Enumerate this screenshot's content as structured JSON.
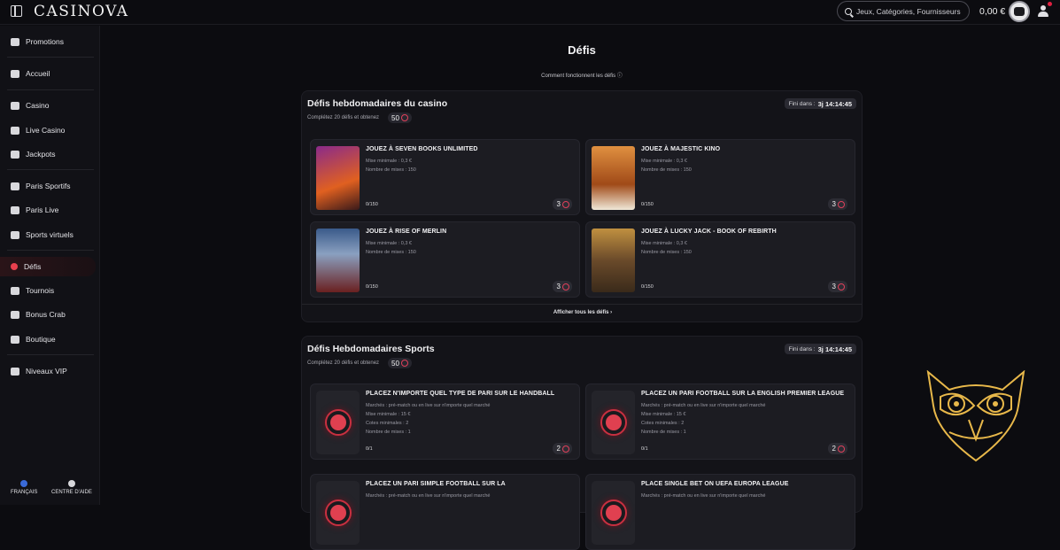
{
  "header": {
    "logo": "CASINOVA",
    "search_placeholder": "Jeux, Catégories, Fournisseurs",
    "balance": "0,00 €"
  },
  "sidebar": {
    "items": [
      {
        "label": "Promotions",
        "icon": "gift-icon"
      },
      {
        "label": "Accueil",
        "icon": "home-icon"
      },
      {
        "label": "Casino",
        "icon": "cards-icon"
      },
      {
        "label": "Live Casino",
        "icon": "live-dealer-icon"
      },
      {
        "label": "Jackpots",
        "icon": "jackpot-icon"
      },
      {
        "label": "Paris Sportifs",
        "icon": "football-icon"
      },
      {
        "label": "Paris Live",
        "icon": "live-tv-icon"
      },
      {
        "label": "Sports virtuels",
        "icon": "virtual-sports-icon"
      },
      {
        "label": "Défis",
        "icon": "target-icon"
      },
      {
        "label": "Tournois",
        "icon": "trophy-icon"
      },
      {
        "label": "Bonus Crab",
        "icon": "crab-icon"
      },
      {
        "label": "Boutique",
        "icon": "shop-icon"
      },
      {
        "label": "Niveaux VIP",
        "icon": "crown-icon"
      }
    ],
    "footer": {
      "language": "FRANÇAIS",
      "help": "CENTRE D'AIDE"
    }
  },
  "page": {
    "title": "Défis",
    "howto": "Comment fonctionnent les défis"
  },
  "casino_section": {
    "title": "Défis hebdomadaires du casino",
    "subtitle": "Complétez 20 défis et obtenez",
    "points": "50",
    "timer_label": "Fini dans :",
    "timer_value": "3j 14:14:45",
    "show_all": "Afficher tous les défis",
    "cards": [
      {
        "title": "JOUEZ À SEVEN BOOKS UNLIMITED",
        "line1": "Mise minimale : 0,3 €",
        "line2": "Nombre de mises : 150",
        "progress": "0/150",
        "points": "3",
        "thumb_color": "#6a2a7a"
      },
      {
        "title": "JOUEZ À MAJESTIC KINO",
        "line1": "Mise minimale : 0,3 €",
        "line2": "Nombre de mises : 150",
        "progress": "0/150",
        "points": "3",
        "thumb_color": "#c8702a"
      },
      {
        "title": "JOUEZ À RISE OF MERLIN",
        "line1": "Mise minimale : 0,3 €",
        "line2": "Nombre de mises : 150",
        "progress": "0/150",
        "points": "3",
        "thumb_color": "#3a4a6a"
      },
      {
        "title": "JOUEZ À LUCKY JACK - BOOK OF REBIRTH",
        "line1": "Mise minimale : 0,3 €",
        "line2": "Nombre de mises : 150",
        "progress": "0/150",
        "points": "3",
        "thumb_color": "#5a3a1a"
      }
    ]
  },
  "sports_section": {
    "title": "Défis Hebdomadaires Sports",
    "subtitle": "Complétez 20 défis et obtenez",
    "points": "50",
    "timer_label": "Fini dans :",
    "timer_value": "3j 14:14:45",
    "cards": [
      {
        "title": "PLACEZ N'IMPORTE QUEL TYPE DE PARI SUR LE HANDBALL",
        "line1": "Marchés : pré-match ou en live sur n'importe quel marché",
        "line2": "Mise minimale : 15 €",
        "line3": "Cotes minimales : 2",
        "line4": "Nombre de mises : 1",
        "progress": "0/1",
        "points": "2"
      },
      {
        "title": "PLACEZ UN PARI FOOTBALL SUR LA ENGLISH PREMIER LEAGUE",
        "line1": "Marchés : pré-match ou en live sur n'importe quel marché",
        "line2": "Mise minimale : 15 €",
        "line3": "Cotes minimales : 2",
        "line4": "Nombre de mises : 1",
        "progress": "0/1",
        "points": "2"
      },
      {
        "title": "PLACEZ UN PARI SIMPLE FOOTBALL SUR LA",
        "line1": "Marchés : pré-match ou en live sur n'importe quel marché"
      },
      {
        "title": "PLACE SINGLE BET ON UEFA EUROPA LEAGUE",
        "line1": "Marchés : pré-match ou en live sur n'importe quel marché"
      }
    ]
  },
  "colors": {
    "accent": "#e0405a",
    "background": "#0c0c10",
    "card": "#1c1c22",
    "owl_gold": "#e8b84a"
  }
}
